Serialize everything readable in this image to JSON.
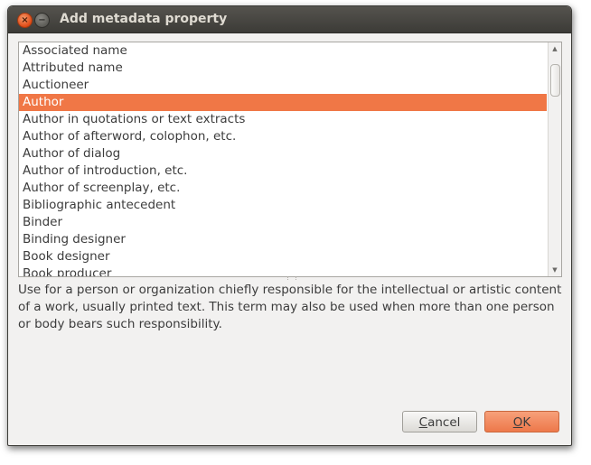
{
  "window": {
    "title": "Add metadata property",
    "close_symbol": "×",
    "minimize_symbol": "−"
  },
  "list": {
    "items": [
      "Associated name",
      "Attributed name",
      "Auctioneer",
      "Author",
      "Author in quotations or text extracts",
      "Author of afterword, colophon, etc.",
      "Author of dialog",
      "Author of introduction, etc.",
      "Author of screenplay, etc.",
      "Bibliographic antecedent",
      "Binder",
      "Binding designer",
      "Book designer",
      "Book producer"
    ],
    "selected_item": "Author",
    "scroll_up_symbol": "▲",
    "scroll_down_symbol": "▼"
  },
  "description": "Use for a person or organization chiefly responsible for the intellectual or artistic content of a work, usually printed text. This term may also be used when more than one person or body bears such responsibility.",
  "buttons": {
    "cancel_mnemonic": "C",
    "cancel_rest": "ancel",
    "ok_mnemonic": "O",
    "ok_rest": "K"
  },
  "colors": {
    "selection": "#f07746",
    "titlebar": "#3c3b37",
    "ok_button": "#ed784a"
  }
}
